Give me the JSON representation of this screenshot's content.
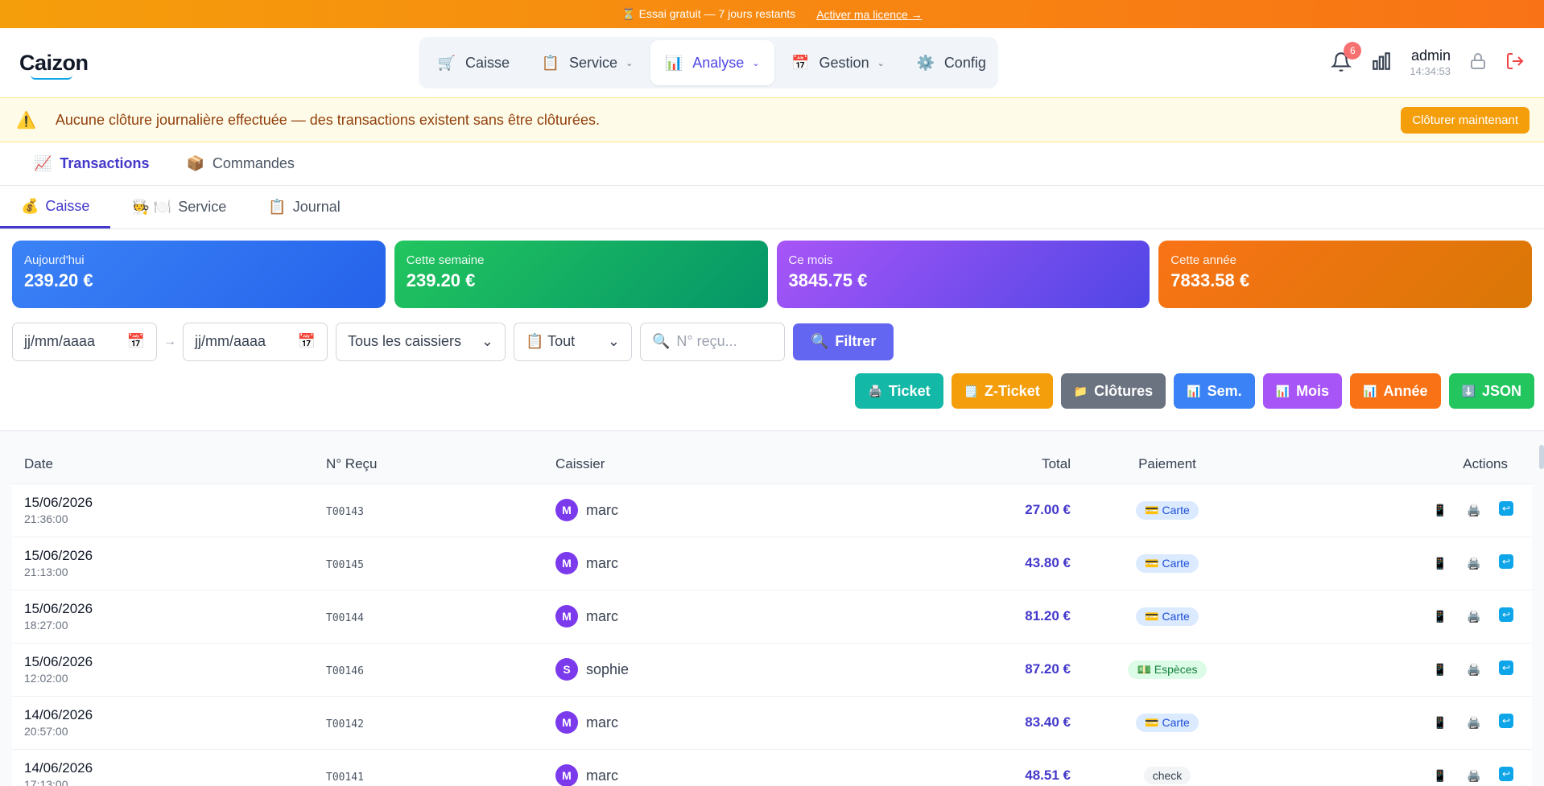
{
  "trial": {
    "text": "⏳ Essai gratuit — 7 jours restants",
    "link": "Activer ma licence →"
  },
  "header": {
    "logo": "Caizon",
    "nav": [
      {
        "label": "Caisse",
        "icon": "🛒"
      },
      {
        "label": "Service",
        "icon": "📋"
      },
      {
        "label": "Analyse",
        "icon": "📊"
      },
      {
        "label": "Gestion",
        "icon": "📅"
      },
      {
        "label": "Config",
        "icon": "⚙️"
      }
    ],
    "notifications": "6",
    "user": "admin",
    "time": "14:34:53"
  },
  "warning": {
    "text": "Aucune clôture journalière effectuée — des transactions existent sans être clôturées.",
    "button": "Clôturer maintenant"
  },
  "tabs_main": [
    {
      "label": "Transactions",
      "icon": "📈"
    },
    {
      "label": "Commandes",
      "icon": "📦"
    }
  ],
  "tabs_sub": [
    {
      "label": "Caisse",
      "icon": "💰"
    },
    {
      "label": "Service",
      "icon": "🧑‍🍳 🍽️"
    },
    {
      "label": "Journal",
      "icon": "📋"
    }
  ],
  "stats": [
    {
      "label": "Aujourd'hui",
      "value": "239.20 €"
    },
    {
      "label": "Cette semaine",
      "value": "239.20 €"
    },
    {
      "label": "Ce mois",
      "value": "3845.75 €"
    },
    {
      "label": "Cette année",
      "value": "7833.58 €"
    }
  ],
  "filters": {
    "date_from": "jj/mm/aaaa",
    "arrow": "→",
    "date_to": "jj/mm/aaaa",
    "cashier": "Tous les caissiers",
    "type": "📋 Tout",
    "receipt_placeholder": "N° reçu...",
    "filter_button": "Filtrer"
  },
  "exports": [
    {
      "label": "Ticket",
      "icon": "🖨️",
      "color": "#14b8a6"
    },
    {
      "label": "Z-Ticket",
      "icon": "🗒️",
      "color": "#f59e0b"
    },
    {
      "label": "Clôtures",
      "icon": "📁",
      "color": "#6b7280"
    },
    {
      "label": "Sem.",
      "icon": "📊",
      "color": "#3b82f6"
    },
    {
      "label": "Mois",
      "icon": "📊",
      "color": "#a855f7"
    },
    {
      "label": "Année",
      "icon": "📊",
      "color": "#f97316"
    },
    {
      "label": "JSON",
      "icon": "⬇️",
      "color": "#22c55e"
    }
  ],
  "table": {
    "headers": {
      "date": "Date",
      "receipt": "N° Reçu",
      "cashier": "Caissier",
      "total": "Total",
      "payment": "Paiement",
      "actions": "Actions"
    },
    "rows": [
      {
        "date": "15/06/2026",
        "time": "21:36:00",
        "receipt": "T00143",
        "initial": "M",
        "cashier": "marc",
        "total": "27.00 €",
        "payment": "💳 Carte",
        "ptype": "card"
      },
      {
        "date": "15/06/2026",
        "time": "21:13:00",
        "receipt": "T00145",
        "initial": "M",
        "cashier": "marc",
        "total": "43.80 €",
        "payment": "💳 Carte",
        "ptype": "card"
      },
      {
        "date": "15/06/2026",
        "time": "18:27:00",
        "receipt": "T00144",
        "initial": "M",
        "cashier": "marc",
        "total": "81.20 €",
        "payment": "💳 Carte",
        "ptype": "card"
      },
      {
        "date": "15/06/2026",
        "time": "12:02:00",
        "receipt": "T00146",
        "initial": "S",
        "cashier": "sophie",
        "total": "87.20 €",
        "payment": "💵 Espèces",
        "ptype": "cash"
      },
      {
        "date": "14/06/2026",
        "time": "20:57:00",
        "receipt": "T00142",
        "initial": "M",
        "cashier": "marc",
        "total": "83.40 €",
        "payment": "💳 Carte",
        "ptype": "card"
      },
      {
        "date": "14/06/2026",
        "time": "17:13:00",
        "receipt": "T00141",
        "initial": "M",
        "cashier": "marc",
        "total": "48.51 €",
        "payment": "check",
        "ptype": "check"
      }
    ]
  }
}
